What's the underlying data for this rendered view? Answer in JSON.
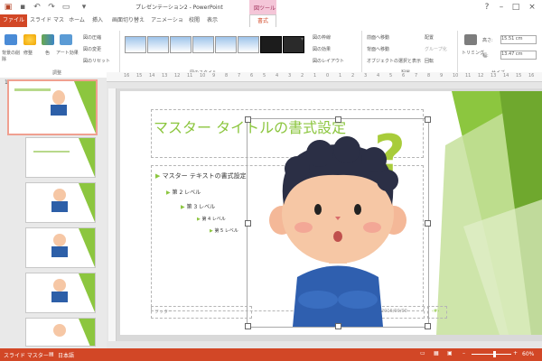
{
  "titlebar": {
    "title": "プレゼンテーション2 - PowerPoint",
    "context_tab": "図ツール"
  },
  "tabs": [
    "ファイル",
    "スライド マスター",
    "ホーム",
    "挿入",
    "画面切り替え",
    "アニメーション",
    "校閲",
    "表示",
    "書式"
  ],
  "ribbon": {
    "adjust_labels": [
      "背景の削除",
      "修整",
      "色",
      "アート効果"
    ],
    "adjust_small": [
      "図の圧縮",
      "図の変更",
      "図のリセット"
    ],
    "adjust_group": "調整",
    "styles_group": "図のスタイル",
    "style_options": [
      "図の枠線",
      "図の効果",
      "図のレイアウト"
    ],
    "arrange_items": [
      "前面へ移動",
      "背面へ移動",
      "オブジェクトの選択と表示",
      "配置",
      "グループ化",
      "回転"
    ],
    "arrange_group": "配置",
    "trim_label": "トリミング",
    "height_label": "高さ:",
    "height_value": "15.51 cm",
    "width_label": "幅:",
    "width_value": "13.47 cm",
    "size_group": "サイズ"
  },
  "ruler": {
    "ticks": [
      "16",
      "15",
      "14",
      "13",
      "12",
      "11",
      "10",
      "9",
      "8",
      "7",
      "6",
      "5",
      "4",
      "3",
      "2",
      "1",
      "0",
      "1",
      "2",
      "3",
      "4",
      "5",
      "6",
      "7",
      "8",
      "9",
      "10",
      "11",
      "12",
      "13",
      "14",
      "15",
      "16"
    ]
  },
  "leftpane": {
    "slide_number": "1"
  },
  "slide": {
    "title": "マスター タイトルの書式設定",
    "bullets": [
      {
        "level": 1,
        "text": "マスター テキストの書式設定"
      },
      {
        "level": 2,
        "text": "第 2 レベル"
      },
      {
        "level": 3,
        "text": "第 3 レベル"
      },
      {
        "level": 4,
        "text": "第 4 レベル"
      },
      {
        "level": 5,
        "text": "第 5 レベル"
      }
    ],
    "footer": "フッター",
    "date": "2016/00/00",
    "page_marker": "‹#›"
  },
  "status": {
    "view": "スライド マスター",
    "language": "日本語",
    "zoom": "60%"
  },
  "colors": {
    "accent": "#d24726",
    "green": "#8cc63f",
    "title_green": "#8cc63f"
  }
}
